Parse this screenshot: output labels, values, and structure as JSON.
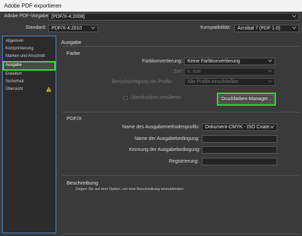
{
  "window": {
    "title": "Adobe PDF exportieren"
  },
  "top": {
    "preset_label": "Adobe PDF-Vorgabe:",
    "preset_value": "[PDF/X-4:2008]",
    "standard_label": "Standard:",
    "standard_value": "PDF/X-4:2010",
    "compat_label": "Kompatibilität:",
    "compat_value": "Acrobat 7 (PDF 1.6)"
  },
  "sidebar": {
    "items": [
      {
        "label": "Allgemein"
      },
      {
        "label": "Komprimierung"
      },
      {
        "label": "Marken und Anschnitt"
      },
      {
        "label": "Ausgabe",
        "selected": true
      },
      {
        "label": "Erweitert"
      },
      {
        "label": "Sicherheit"
      },
      {
        "label": "Übersicht",
        "warning": true
      }
    ]
  },
  "panel": {
    "title": "Ausgabe",
    "farbe": {
      "heading": "Farbe",
      "conversion_label": "Farbkonvertierung:",
      "conversion_value": "Keine Farbkonvertierung",
      "target_label": "Ziel:",
      "target_value": "n. zutr.",
      "profile_label": "Berücksichtigung der Profile:",
      "profile_value": "Alle Profile einschließen",
      "overprint_label": "Überdrucken simulieren",
      "ink_manager_button": "Druckfarben-Manager..."
    },
    "pdfx": {
      "heading": "PDF/X",
      "profile_name_label": "Name des Ausgabemethodenprofils:",
      "profile_name_value": "Dokument-CMYK - ISO Coate...",
      "condition_name_label": "Name der Ausgabebedingung:",
      "condition_id_label": "Kennung der Ausgabebedingung:",
      "registry_label": "Registrierung:"
    },
    "description": {
      "heading": "Beschreibung",
      "text": "Zeigen Sie auf eine Option, um eine Beschreibung einzublenden."
    }
  }
}
